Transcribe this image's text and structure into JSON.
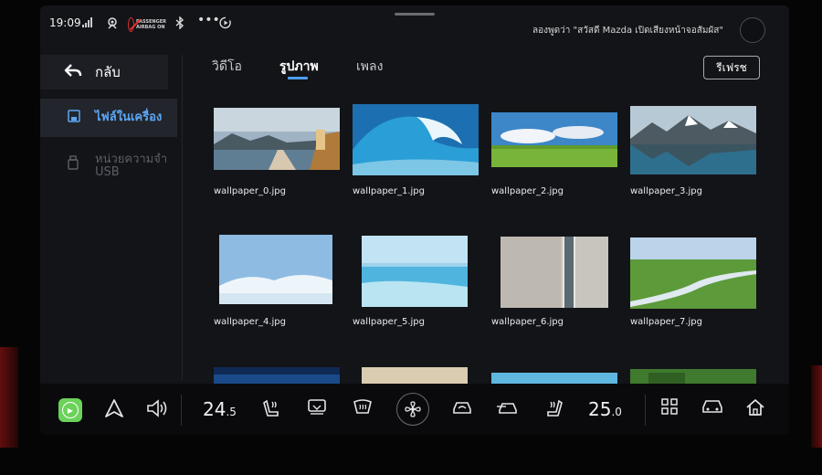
{
  "status": {
    "time": "19:09",
    "airbag_text": "PASSENGER AIRBAG ON",
    "voice_hint": "ลองพูดว่า \"สวัสดี Mazda เปิดเสียงหน้าจอสัมผัส\""
  },
  "sidebar": {
    "back_label": "กลับ",
    "items": [
      {
        "label": "ไฟล์ในเครื่อง",
        "icon": "save-icon",
        "active": true
      },
      {
        "label": "หน่วยความจำ USB",
        "icon": "usb-drive-icon",
        "active": false
      }
    ]
  },
  "tabs": [
    {
      "label": "วิดีโอ",
      "active": false
    },
    {
      "label": "รูปภาพ",
      "active": true
    },
    {
      "label": "เพลง",
      "active": false
    }
  ],
  "refresh_label": "รีเฟรช",
  "files": [
    {
      "name": "wallpaper_0.jpg"
    },
    {
      "name": "wallpaper_1.jpg"
    },
    {
      "name": "wallpaper_2.jpg"
    },
    {
      "name": "wallpaper_3.jpg"
    },
    {
      "name": "wallpaper_4.jpg"
    },
    {
      "name": "wallpaper_5.jpg"
    },
    {
      "name": "wallpaper_6.jpg"
    },
    {
      "name": "wallpaper_7.jpg"
    }
  ],
  "dock": {
    "temp_left_main": "24",
    "temp_left_decimal": ".5",
    "temp_right_main": "25",
    "temp_right_decimal": ".0"
  },
  "colors": {
    "accent": "#4d9ef0",
    "active_sidebar": "#5ba6f3",
    "carplay": "#6bd25a",
    "airbag_warning": "#e03030"
  }
}
